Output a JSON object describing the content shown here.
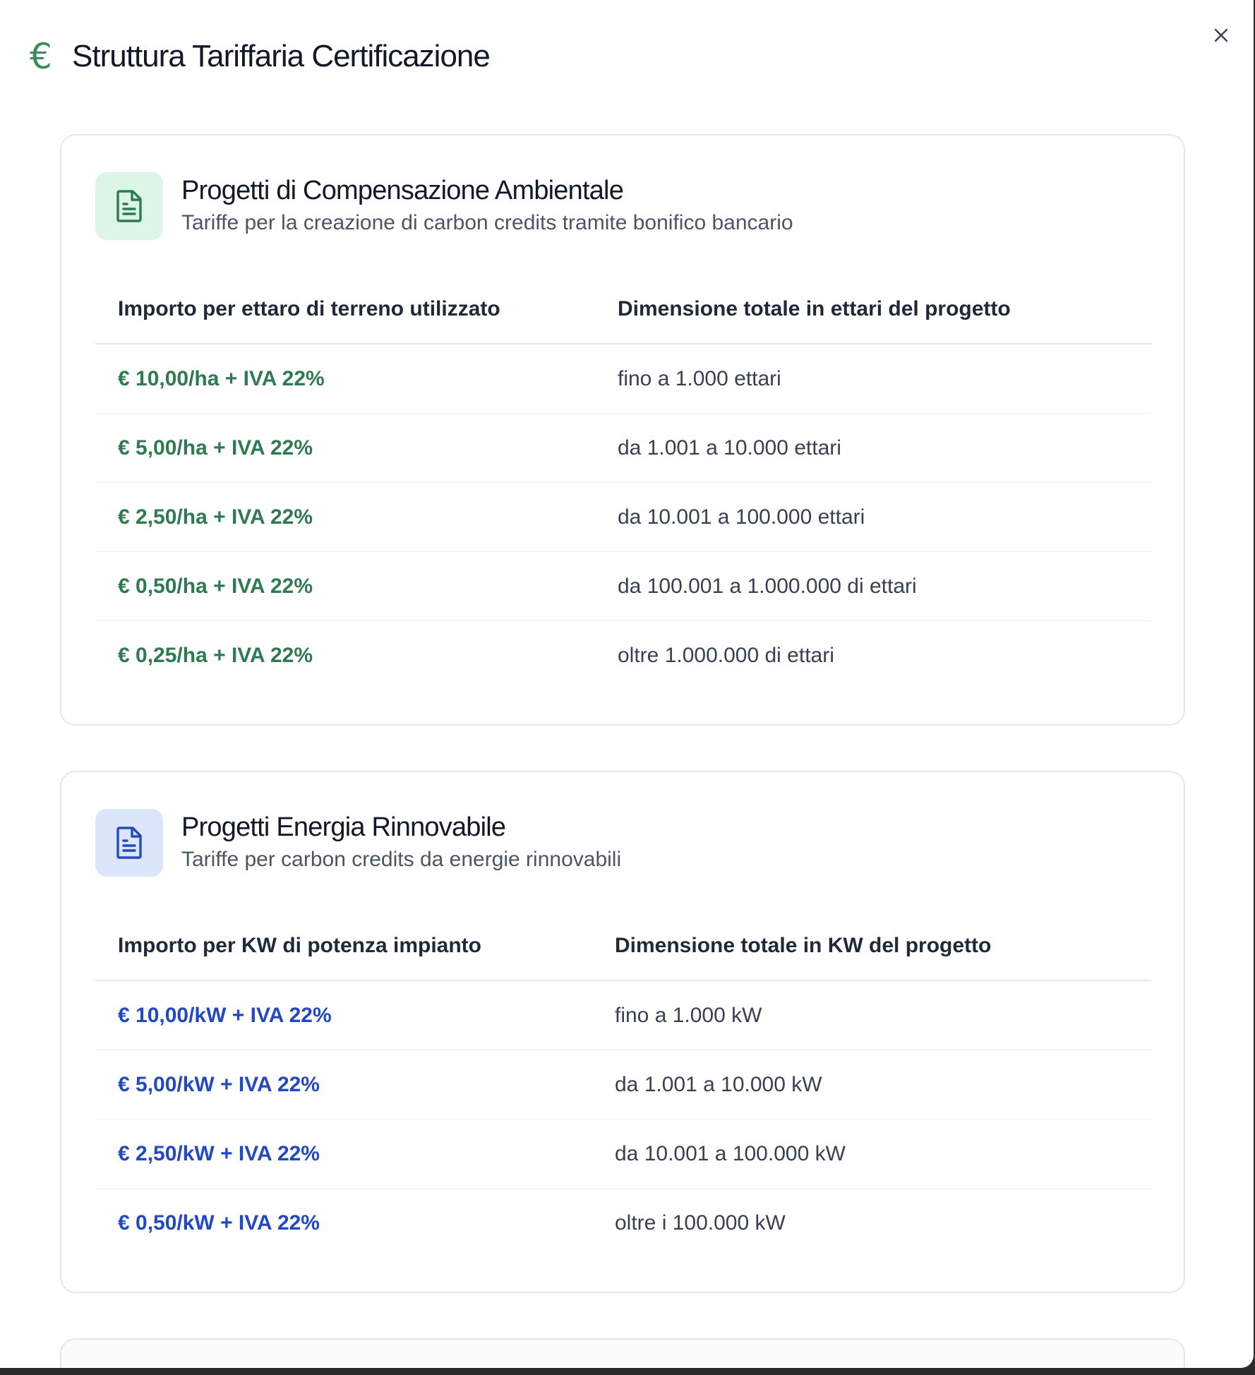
{
  "dialog": {
    "title": "Struttura Tariffaria Certificazione",
    "icon": "euro-icon",
    "close_icon": "close-icon"
  },
  "colors": {
    "green_accent": "#2f7a52",
    "blue_accent": "#2348c4",
    "green_tile": "#dcf5e6",
    "blue_tile": "#dbe6fb"
  },
  "cards": [
    {
      "title": "Progetti di Compensazione Ambientale",
      "subtitle": "Tariffe per la creazione di carbon credits tramite bonifico bancario",
      "icon": "document-icon",
      "columns": [
        "Importo per ettaro di terreno utilizzato",
        "Dimensione totale in ettari del progetto"
      ],
      "rows": [
        {
          "price": "€ 10,00/ha + IVA 22%",
          "range": "fino a 1.000 ettari"
        },
        {
          "price": "€ 5,00/ha + IVA 22%",
          "range": "da 1.001 a 10.000 ettari"
        },
        {
          "price": "€ 2,50/ha + IVA 22%",
          "range": "da 10.001 a 100.000 ettari"
        },
        {
          "price": "€ 0,50/ha + IVA 22%",
          "range": "da 100.001 a 1.000.000 di ettari"
        },
        {
          "price": "€ 0,25/ha + IVA 22%",
          "range": "oltre 1.000.000 di ettari"
        }
      ]
    },
    {
      "title": "Progetti Energia Rinnovabile",
      "subtitle": "Tariffe per carbon credits da energie rinnovabili",
      "icon": "document-icon",
      "columns": [
        "Importo per KW di potenza impianto",
        "Dimensione totale in KW del progetto"
      ],
      "rows": [
        {
          "price": "€ 10,00/kW + IVA 22%",
          "range": "fino a 1.000 kW"
        },
        {
          "price": "€ 5,00/kW + IVA 22%",
          "range": "da 1.001 a 10.000 kW"
        },
        {
          "price": "€ 2,50/kW + IVA 22%",
          "range": "da 10.001 a 100.000 kW"
        },
        {
          "price": "€ 0,50/kW + IVA 22%",
          "range": "oltre i 100.000 kW"
        }
      ]
    }
  ]
}
